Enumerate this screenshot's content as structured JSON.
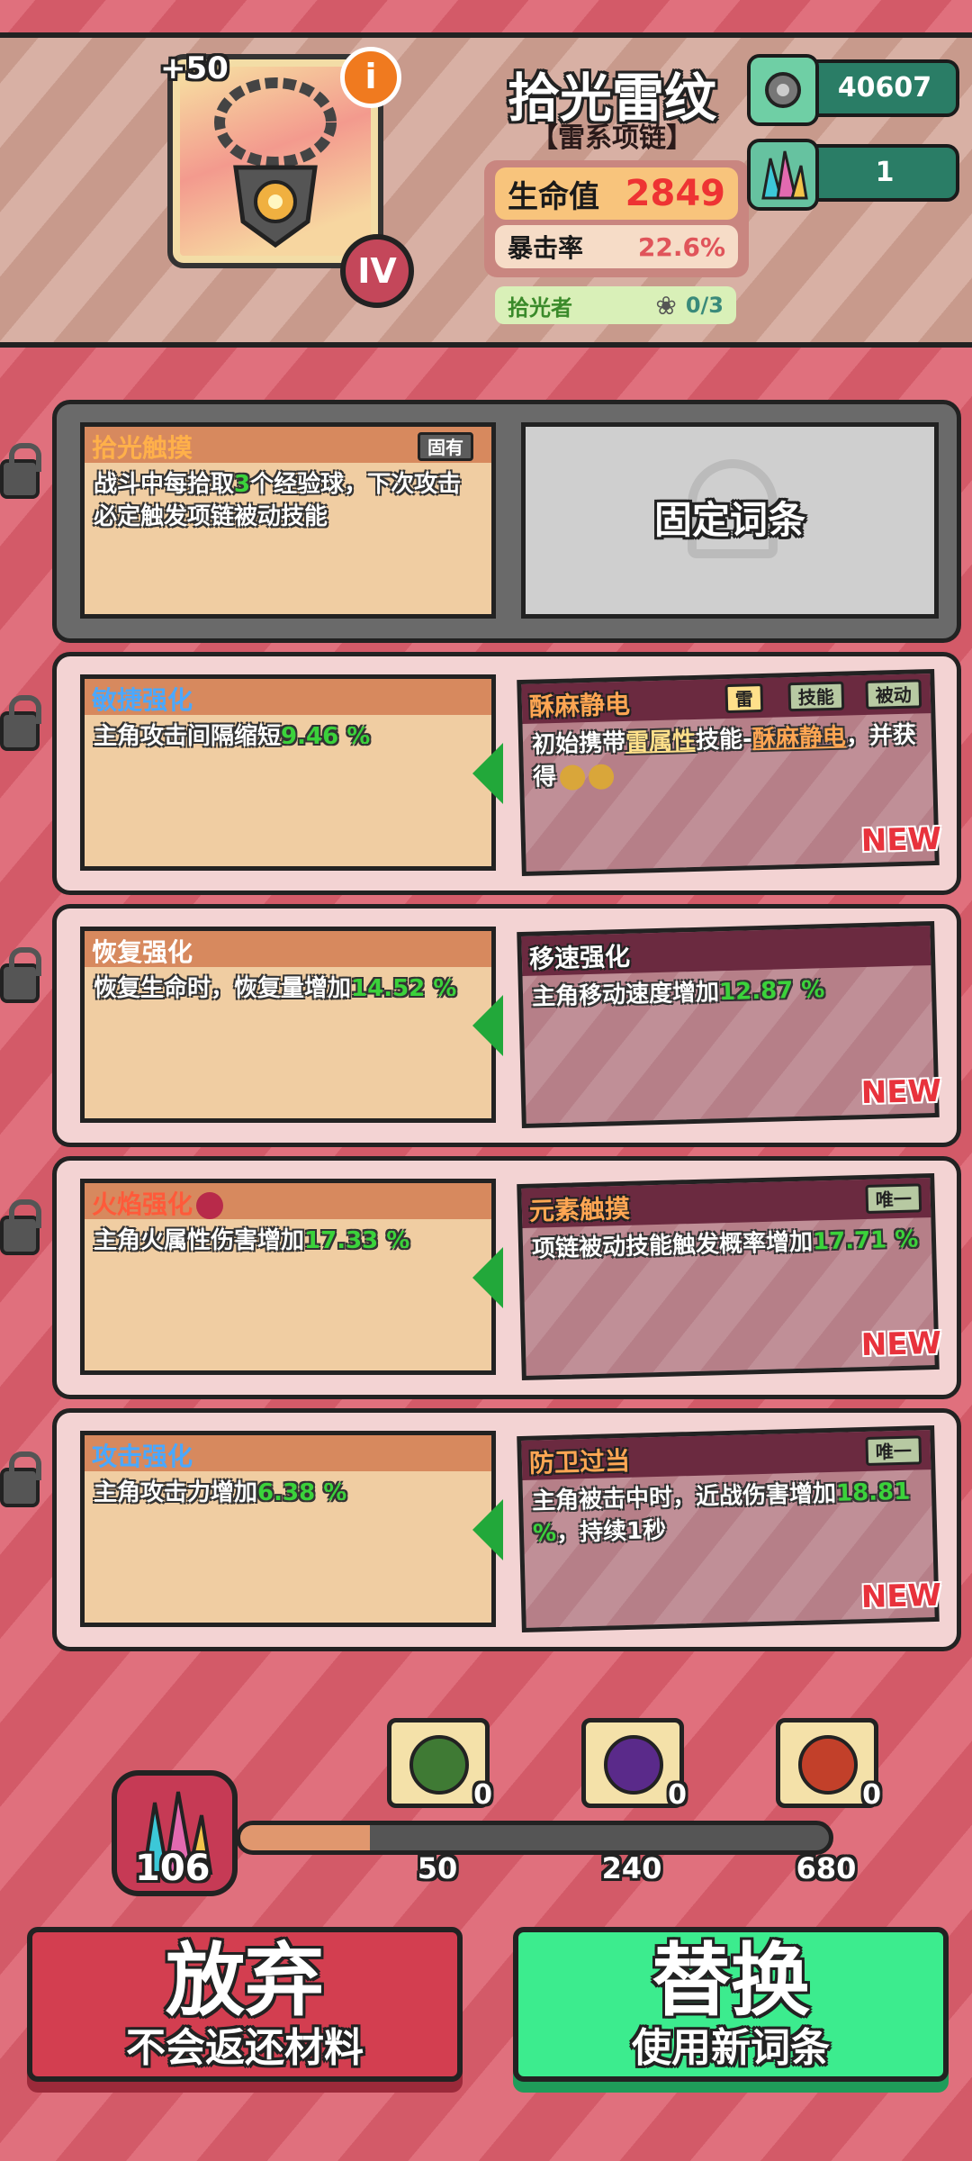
{
  "item": {
    "name": "拾光雷纹",
    "type": "【雷系项链】",
    "enhance": "+50",
    "tier": "IV",
    "info_icon": "i",
    "stats": [
      {
        "label": "生命值",
        "value": "2849"
      },
      {
        "label": "暴击率",
        "value": "22.6%"
      }
    ],
    "collector": {
      "label": "拾光者",
      "count": "0/3"
    }
  },
  "resources": {
    "gear": "40607",
    "crystal": "1"
  },
  "fixed_slot": {
    "label": "固定词条"
  },
  "rows": [
    {
      "old": {
        "name": "拾光触摸",
        "tag": "固有",
        "text_a": "战斗中每拾取",
        "hl": "3",
        "text_b": "个经验球，下次攻击必定触发项链被动技能"
      }
    },
    {
      "old": {
        "name": "敏捷强化",
        "text": "主角攻击间隔缩短",
        "value": "9.46 %"
      },
      "new": {
        "name": "酥麻静电",
        "tags": [
          "雷",
          "技能",
          "被动"
        ],
        "text_a": "初始携带",
        "hl1": "雷属性",
        "text_b": "技能-",
        "hl2": "酥麻静电",
        "text_c": "，并获得",
        "new_label": "NEW"
      }
    },
    {
      "old": {
        "name": "恢复强化",
        "text": "恢复生命时，恢复量增加",
        "value": "14.52 %"
      },
      "new": {
        "name": "移速强化",
        "text": "主角移动速度增加",
        "value": "12.87 %",
        "new_label": "NEW"
      }
    },
    {
      "old": {
        "name": "火焰强化",
        "text": "主角火属性伤害增加",
        "value": "17.33 %"
      },
      "new": {
        "name": "元素触摸",
        "tag": "唯一",
        "text": "项链被动技能触发概率增加",
        "value": "17.71 %",
        "new_label": "NEW"
      }
    },
    {
      "old": {
        "name": "攻击强化",
        "text": "主角攻击力增加",
        "value": "6.38 %"
      },
      "new": {
        "name": "防卫过当",
        "tag": "唯一",
        "text_a": "主角被击中时，近战伤害增加",
        "value": "18.81 %",
        "text_b": "，持续1秒",
        "new_label": "NEW"
      }
    }
  ],
  "materials": {
    "current": "106",
    "progress": 0.22,
    "milestones": [
      {
        "threshold": "50",
        "count": "0",
        "color": "#3f7a34"
      },
      {
        "threshold": "240",
        "count": "0",
        "color": "#5a2a8a"
      },
      {
        "threshold": "680",
        "count": "0",
        "color": "#c2402a"
      }
    ]
  },
  "buttons": {
    "giveup": {
      "title": "放弃",
      "sub": "不会返还材料"
    },
    "replace": {
      "title": "替换",
      "sub": "使用新词条"
    }
  }
}
